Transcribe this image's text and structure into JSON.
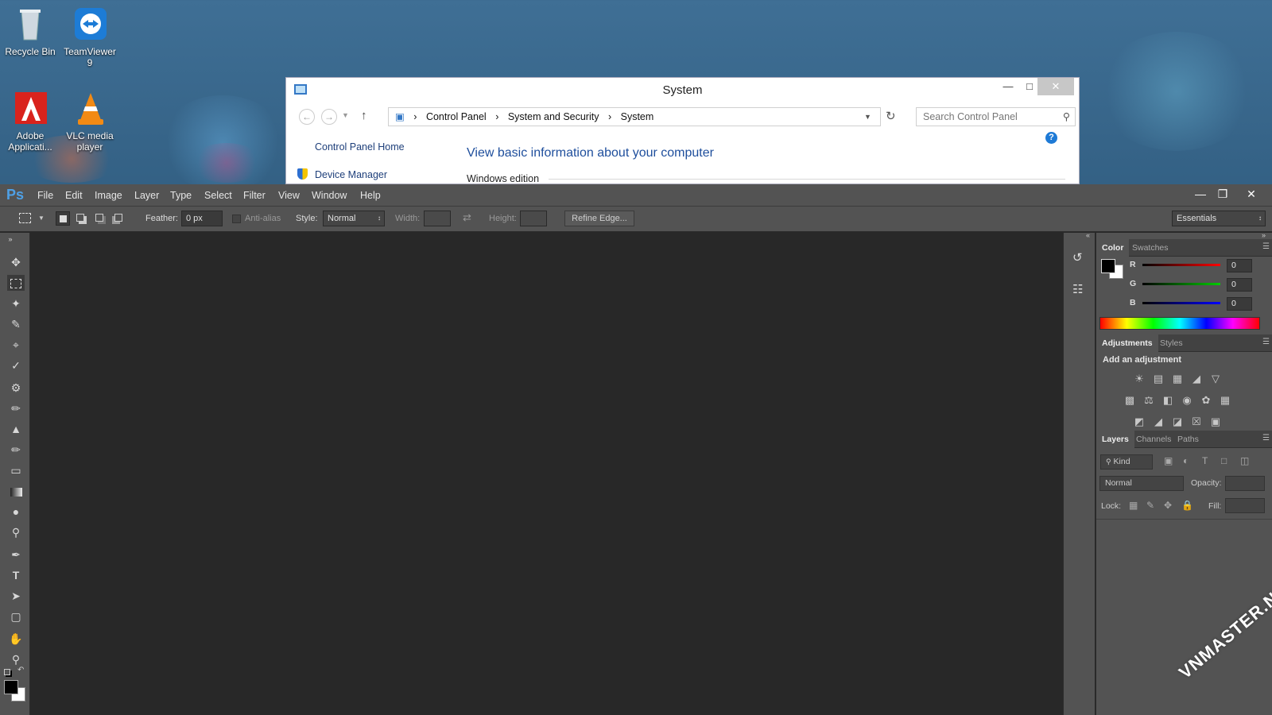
{
  "desktop": {
    "icons": [
      {
        "label": "Recycle Bin",
        "icon": "recycle-bin-icon"
      },
      {
        "label": "TeamViewer 9",
        "icon": "teamviewer-icon"
      },
      {
        "label": "Adobe Applicati...",
        "icon": "adobe-icon"
      },
      {
        "label": "VLC media player",
        "icon": "vlc-icon"
      }
    ],
    "watermark": "VNMASTER.NET"
  },
  "control_panel": {
    "title": "System",
    "breadcrumb": [
      "Control Panel",
      "System and Security",
      "System"
    ],
    "search_placeholder": "Search Control Panel",
    "sidebar_home": "Control Panel Home",
    "sidebar_device_manager": "Device Manager",
    "heading": "View basic information about your computer",
    "section": "Windows edition",
    "link_color": "#1e4e9c"
  },
  "photoshop": {
    "logo": "Ps",
    "menu": [
      "File",
      "Edit",
      "Image",
      "Layer",
      "Type",
      "Select",
      "Filter",
      "View",
      "Window",
      "Help"
    ],
    "options": {
      "feather_label": "Feather:",
      "feather_value": "0 px",
      "antialias_label": "Anti-alias",
      "style_label": "Style:",
      "style_value": "Normal",
      "width_label": "Width:",
      "height_label": "Height:",
      "refine_edge": "Refine Edge...",
      "workspace": "Essentials"
    },
    "color_panel": {
      "tabs": [
        "Color",
        "Swatches"
      ],
      "r_label": "R",
      "r_value": "0",
      "g_label": "G",
      "g_value": "0",
      "b_label": "B",
      "b_value": "0"
    },
    "adjustments_panel": {
      "tabs": [
        "Adjustments",
        "Styles"
      ],
      "heading": "Add an adjustment"
    },
    "layers_panel": {
      "tabs": [
        "Layers",
        "Channels",
        "Paths"
      ],
      "kind": "Kind",
      "blend_mode": "Normal",
      "opacity_label": "Opacity:",
      "lock_label": "Lock:",
      "fill_label": "Fill:"
    }
  }
}
